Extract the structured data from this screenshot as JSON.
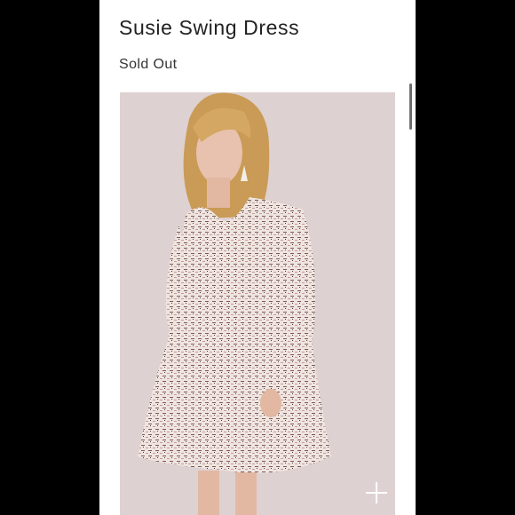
{
  "product": {
    "title": "Susie Swing Dress",
    "status": "Sold Out",
    "image_icon": "zoom-plus-icon"
  },
  "colors": {
    "background": "#000000",
    "panel": "#ffffff",
    "photo_backdrop": "#ded1d1",
    "dress": "#efe5e0",
    "text": "#222222"
  }
}
